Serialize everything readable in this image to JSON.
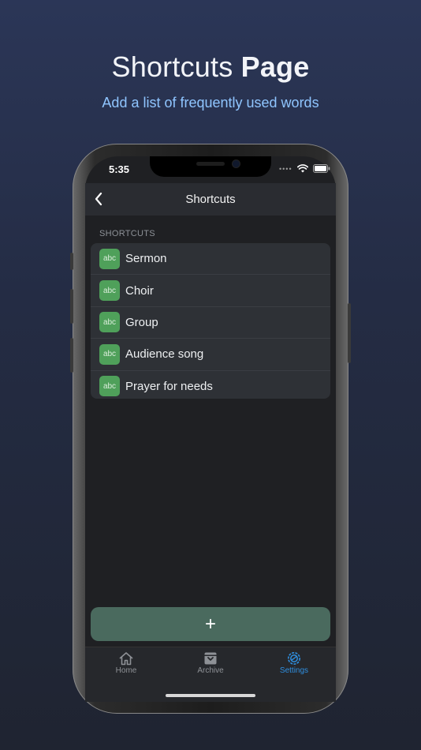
{
  "promo": {
    "title_regular": "Shortcuts ",
    "title_bold": "Page",
    "subtitle": "Add a list of frequently used words"
  },
  "status_bar": {
    "time": "5:35",
    "icons": [
      "signal-dots-icon",
      "wifi-icon",
      "battery-icon"
    ]
  },
  "nav": {
    "title": "Shortcuts",
    "back_icon": "chevron-left-icon"
  },
  "section": {
    "title": "SHORTCUTS"
  },
  "shortcuts": [
    {
      "badge": "abc",
      "label": "Sermon"
    },
    {
      "badge": "abc",
      "label": "Choir"
    },
    {
      "badge": "abc",
      "label": "Group"
    },
    {
      "badge": "abc",
      "label": "Audience song"
    },
    {
      "badge": "abc",
      "label": "Prayer for needs"
    }
  ],
  "add_button": {
    "label": "+"
  },
  "tabs": [
    {
      "label": "Home",
      "icon": "home-icon",
      "active": false
    },
    {
      "label": "Archive",
      "icon": "archive-icon",
      "active": false
    },
    {
      "label": "Settings",
      "icon": "settings-icon",
      "active": true
    }
  ],
  "colors": {
    "accent": "#2f8fe0",
    "tab_inactive": "#8e9196",
    "badge": "#4fa05a",
    "add_button": "#4a6a5e",
    "subtitle": "#8fc5ff"
  }
}
